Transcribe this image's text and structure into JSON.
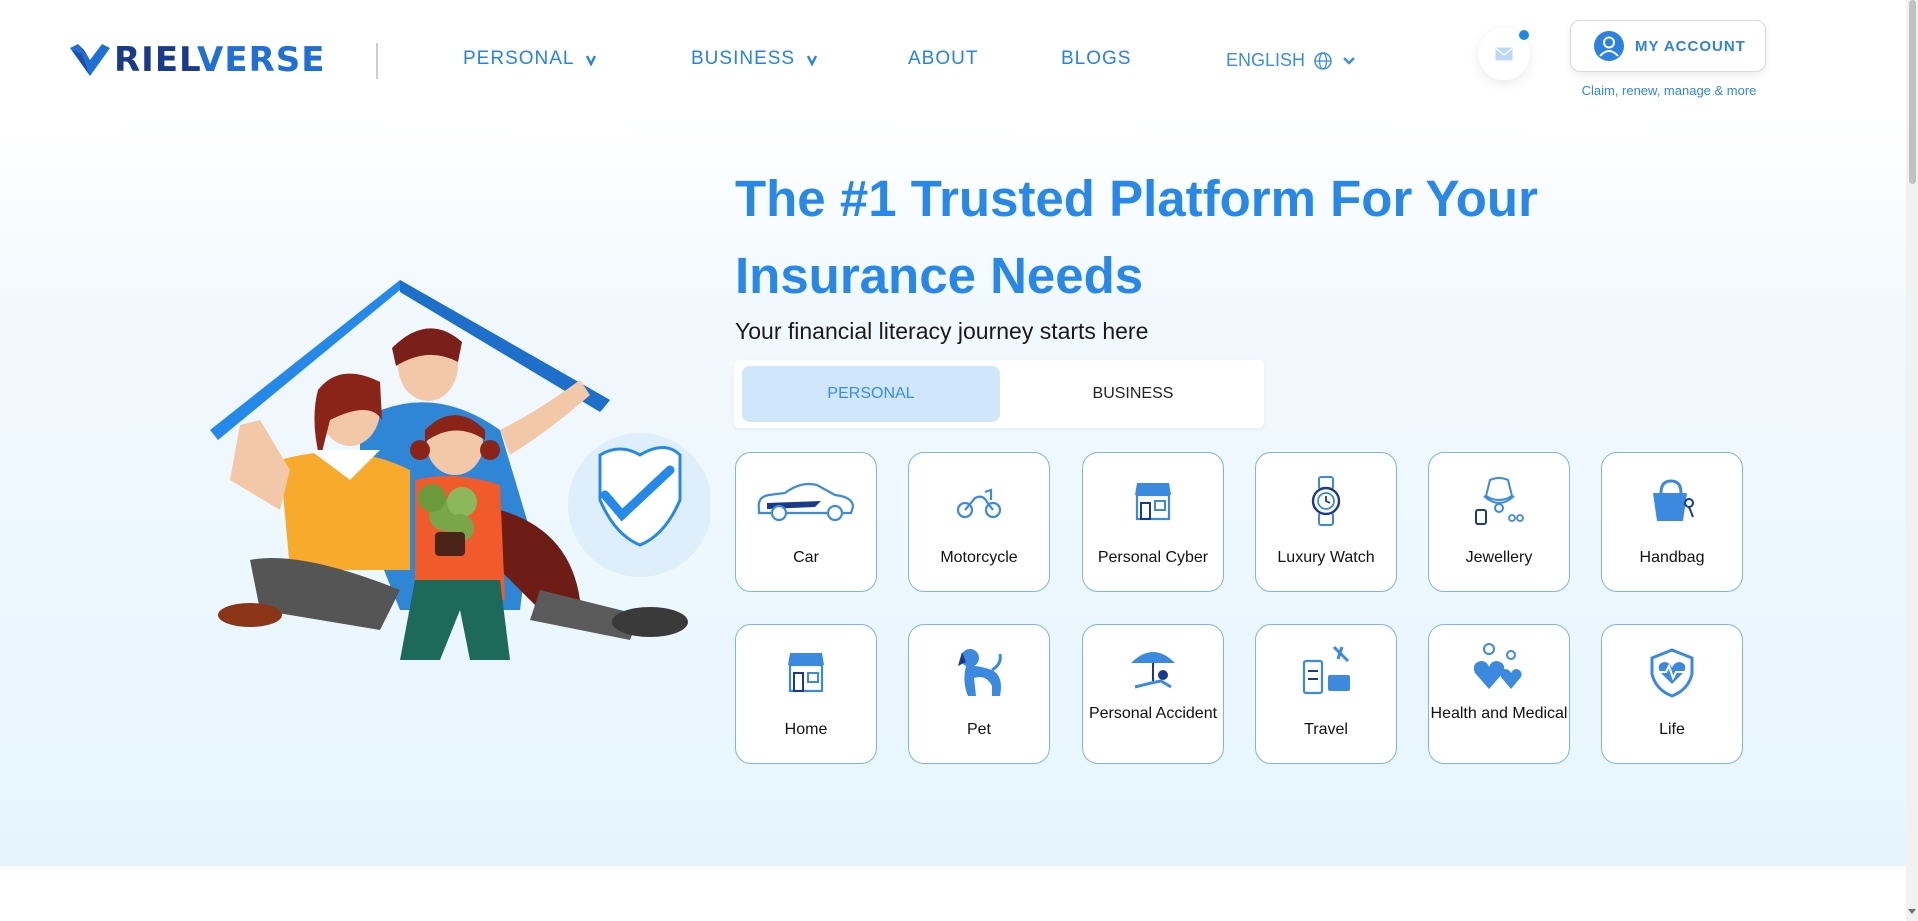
{
  "brand": {
    "logo_text_left": "RIEL",
    "logo_text_right": "VERSE",
    "logo_icon": "heart-v-icon",
    "primary_color": "#2788ea",
    "dark_color": "#1a3a8a"
  },
  "nav": {
    "items": [
      {
        "label": "PERSONAL",
        "has_dropdown": true
      },
      {
        "label": "BUSINESS",
        "has_dropdown": true
      },
      {
        "label": "ABOUT",
        "has_dropdown": false
      },
      {
        "label": "BLOGS",
        "has_dropdown": false
      }
    ],
    "language": "ENGLISH",
    "language_icon": "globe-icon",
    "mail_icon": "mail-icon",
    "account_label": "MY ACCOUNT",
    "account_icon": "user-icon",
    "account_subtext": "Claim, renew, manage & more"
  },
  "hero": {
    "title_line1": "The #1 Trusted Platform For Your",
    "title_line2": "Insurance Needs",
    "subtitle": "Your financial literacy journey starts here",
    "tabs": [
      {
        "label": "PERSONAL",
        "active": true
      },
      {
        "label": "BUSINESS",
        "active": false
      }
    ]
  },
  "products": [
    {
      "label": "Car",
      "icon": "car-icon"
    },
    {
      "label": "Motorcycle",
      "icon": "motorcycle-icon"
    },
    {
      "label": "Personal Cyber",
      "icon": "cyber-house-icon"
    },
    {
      "label": "Luxury Watch",
      "icon": "watch-icon"
    },
    {
      "label": "Jewellery",
      "icon": "jewellery-icon"
    },
    {
      "label": "Handbag",
      "icon": "handbag-icon"
    },
    {
      "label": "Home",
      "icon": "home-icon"
    },
    {
      "label": "Pet",
      "icon": "pet-icon"
    },
    {
      "label": "Personal Accident",
      "icon": "accident-icon"
    },
    {
      "label": "Travel",
      "icon": "travel-icon"
    },
    {
      "label": "Health and Medical",
      "icon": "health-icon"
    },
    {
      "label": "Life",
      "icon": "life-shield-icon"
    }
  ]
}
